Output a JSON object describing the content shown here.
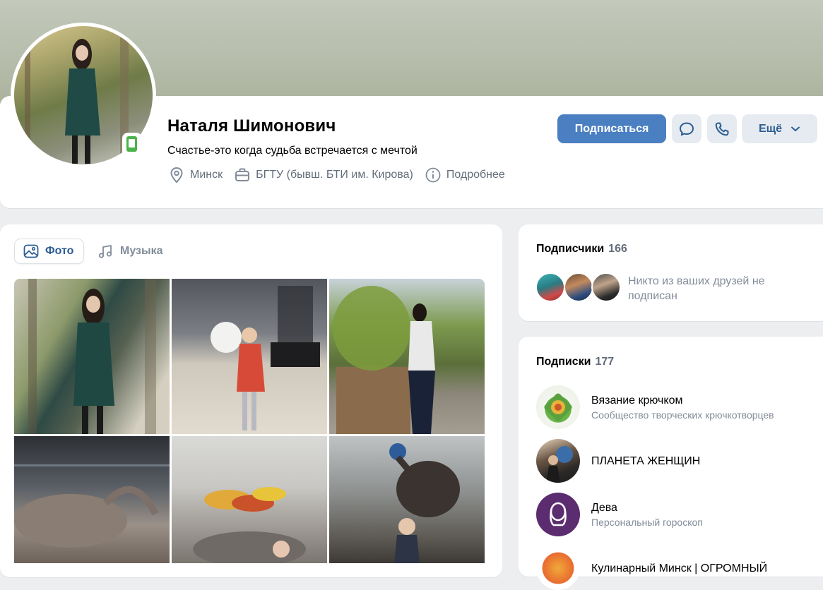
{
  "profile": {
    "name": "Наталя Шимонович",
    "status": "Счастье-это когда судьба встречается с мечтой",
    "city": "Минск",
    "education": "БГТУ (бывш. БТИ им. Кирова)",
    "details_label": "Подробнее",
    "online_mobile": true
  },
  "actions": {
    "subscribe": "Подписаться",
    "message_icon": "message-icon",
    "call_icon": "phone-icon",
    "more": "Ещё"
  },
  "tabs": [
    {
      "label": "Фото",
      "icon": "photo-icon",
      "active": true
    },
    {
      "label": "Музыка",
      "icon": "music-icon",
      "active": false
    }
  ],
  "followers": {
    "title": "Подписчики",
    "count": "166",
    "note": "Никто из ваших друзей не подписан"
  },
  "subscriptions": {
    "title": "Подписки",
    "count": "177",
    "groups": [
      {
        "name": "Вязание крючком",
        "subtitle": "Сообщество творческих крючкотворцев"
      },
      {
        "name": "ПЛАНЕТА ЖЕНЩИН",
        "subtitle": ""
      },
      {
        "name": "Дева",
        "subtitle": "Персональный гороскоп"
      },
      {
        "name": "Кулинарный  Минск | ОГРОМНЫЙ",
        "subtitle": ""
      }
    ]
  },
  "colors": {
    "accent": "#4a7fc1",
    "link": "#2c5d93",
    "secondary_text": "#818c99",
    "online": "#4bb34b"
  }
}
